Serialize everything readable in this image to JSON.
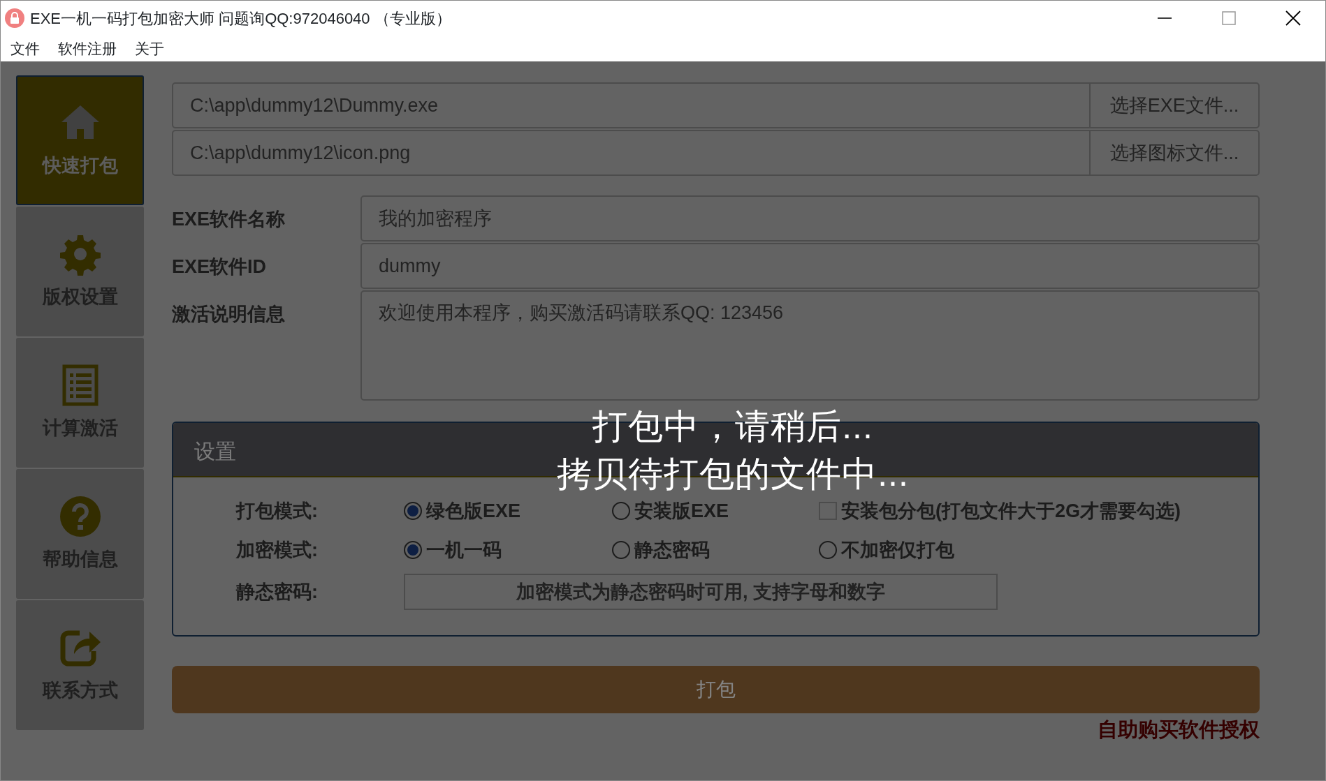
{
  "window": {
    "title": "EXE一机一码打包加密大师 问题询QQ:972046040 （专业版）"
  },
  "menu": [
    "文件",
    "软件注册",
    "关于"
  ],
  "sidebar": {
    "items": [
      {
        "label": "快速打包",
        "selected": true
      },
      {
        "label": "版权设置",
        "selected": false
      },
      {
        "label": "计算激活",
        "selected": false
      },
      {
        "label": "帮助信息",
        "selected": false
      },
      {
        "label": "联系方式",
        "selected": false
      }
    ]
  },
  "files": [
    {
      "value": "C:\\app\\dummy12\\Dummy.exe",
      "button": "选择EXE文件..."
    },
    {
      "value": "C:\\app\\dummy12\\icon.png",
      "button": "选择图标文件..."
    }
  ],
  "fields": [
    {
      "label": "EXE软件名称",
      "value": "我的加密程序",
      "kind": "input"
    },
    {
      "label": "EXE软件ID",
      "value": "dummy",
      "kind": "input"
    },
    {
      "label": "激活说明信息",
      "value": "欢迎使用本程序，购买激活码请联系QQ: 123456",
      "kind": "textarea"
    }
  ],
  "settings": {
    "title": "设置",
    "rows": [
      {
        "label": "打包模式:",
        "kind": "options",
        "options": [
          {
            "kind": "radio",
            "label": "绿色版EXE",
            "selected": true
          },
          {
            "kind": "radio",
            "label": "安装版EXE",
            "selected": false
          },
          {
            "kind": "checkbox",
            "label": "安装包分包(打包文件大于2G才需要勾选)",
            "checked": false
          }
        ]
      },
      {
        "label": "加密模式:",
        "kind": "options",
        "options": [
          {
            "kind": "radio",
            "label": "一机一码",
            "selected": true
          },
          {
            "kind": "radio",
            "label": "静态密码",
            "selected": false
          },
          {
            "kind": "radio",
            "label": "不加密仅打包",
            "selected": false
          }
        ]
      },
      {
        "label": "静态密码:",
        "kind": "input",
        "placeholder": "加密模式为静态密码时可用, 支持字母和数字"
      }
    ]
  },
  "pack_button": "打包",
  "buy_link": "自助购买软件授权",
  "overlay": {
    "lines": [
      "打包中，请稍后...",
      "拷贝待打包的文件中..."
    ]
  }
}
